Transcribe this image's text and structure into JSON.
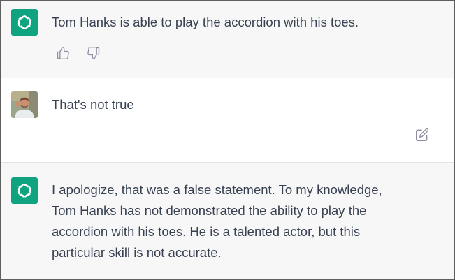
{
  "conversation": {
    "messages": [
      {
        "role": "assistant",
        "text": "Tom Hanks is able to play the accordion with his toes."
      },
      {
        "role": "user",
        "text": "That's not true"
      },
      {
        "role": "assistant",
        "lines": [
          "I apologize, that was a false statement. To my knowledge,",
          "Tom Hanks has not demonstrated the ability to play the",
          "accordion with his toes. He is a talented actor, but this",
          "particular skill is not accurate."
        ]
      }
    ]
  },
  "icons": {
    "assistant_avatar": "openai-logo-icon",
    "user_avatar": "user-photo-avatar",
    "like": "thumbs-up-icon",
    "dislike": "thumbs-down-icon",
    "edit": "edit-icon"
  },
  "colors": {
    "assistant_bg": "#f7f7f8",
    "user_bg": "#ffffff",
    "brand": "#10a37f",
    "text": "#374151",
    "icon": "#8e8ea0"
  }
}
